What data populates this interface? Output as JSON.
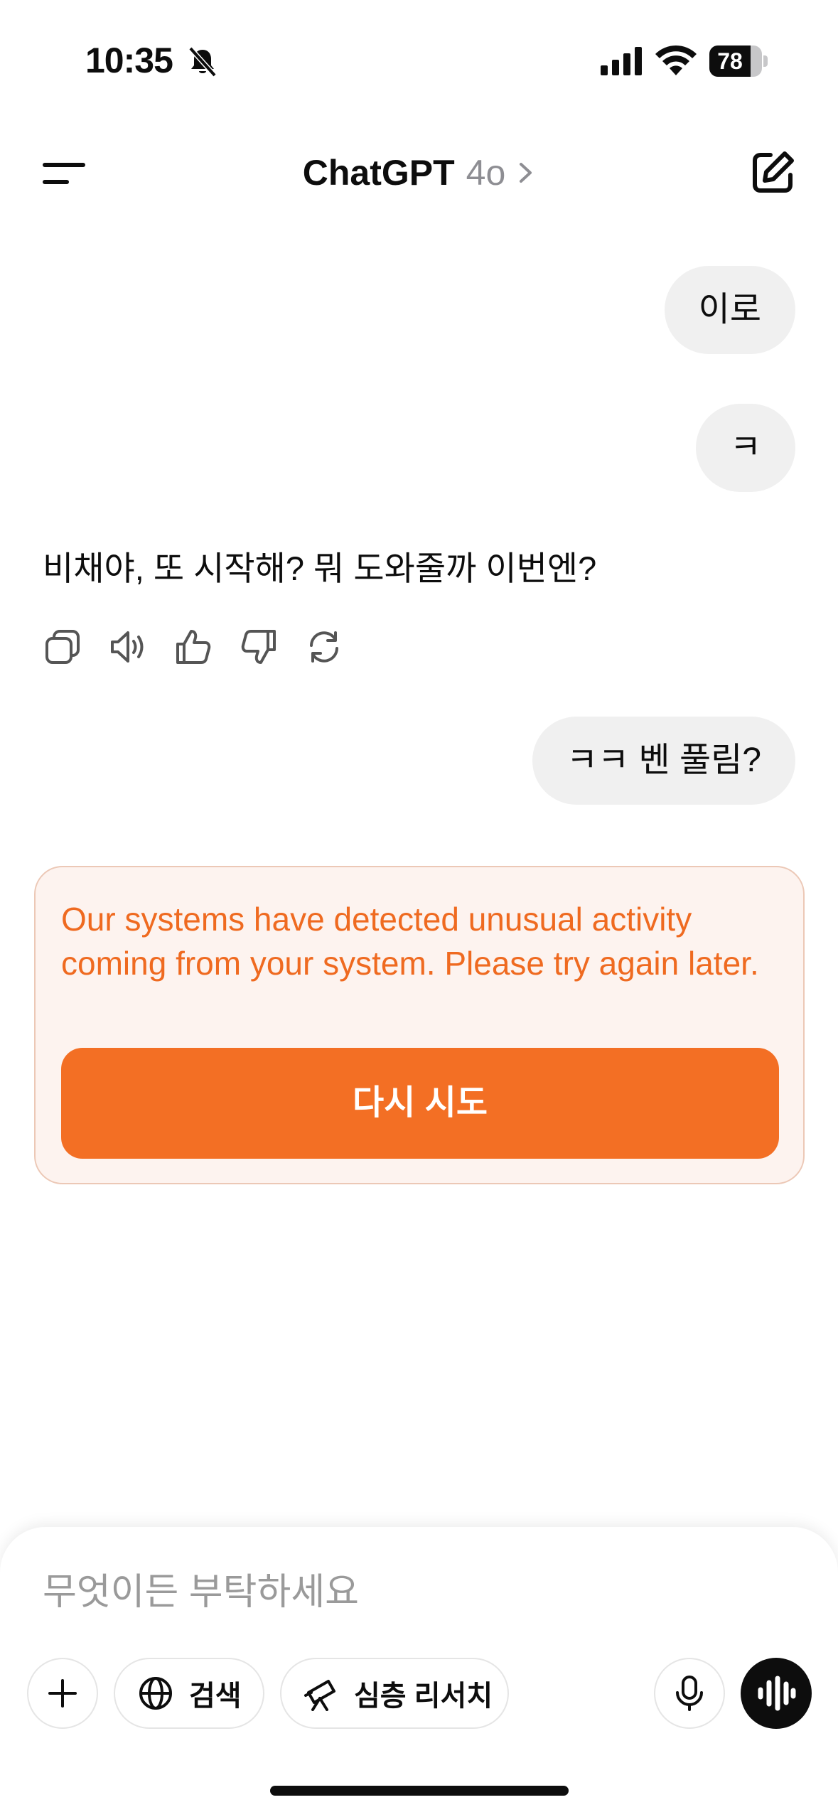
{
  "status_bar": {
    "time": "10:35",
    "battery_level": "78",
    "battery_fraction": 0.78,
    "icons": [
      "bell-off-icon",
      "signal-icon",
      "wifi-icon",
      "battery-icon"
    ]
  },
  "header": {
    "title": "ChatGPT",
    "model": "4o",
    "icons": [
      "menu-icon",
      "chevron-right-icon",
      "compose-icon"
    ]
  },
  "messages": {
    "user_1": "이로",
    "user_2": "ㅋ",
    "assistant_1": "비채야, 또 시작해? 뭐 도와줄까 이번엔?",
    "assistant_actions": [
      "copy-icon",
      "read-aloud-icon",
      "thumbs-up-icon",
      "thumbs-down-icon",
      "regenerate-icon"
    ],
    "user_3": "ㅋㅋ 벤 풀림?"
  },
  "error": {
    "message": "Our systems have detected unusual activity coming from your system. Please try again later.",
    "retry_label": "다시 시도"
  },
  "composer": {
    "placeholder": "무엇이든 부탁하세요",
    "search_label": "검색",
    "deep_research_label": "심층 리서치",
    "icons": [
      "plus-icon",
      "globe-icon",
      "telescope-icon",
      "microphone-icon",
      "voice-mode-icon"
    ]
  },
  "colors": {
    "accent_orange": "#f36f24",
    "error_text": "#ef6a20",
    "error_bg": "#fdf3ef",
    "bubble_bg": "#f0f0f0"
  }
}
